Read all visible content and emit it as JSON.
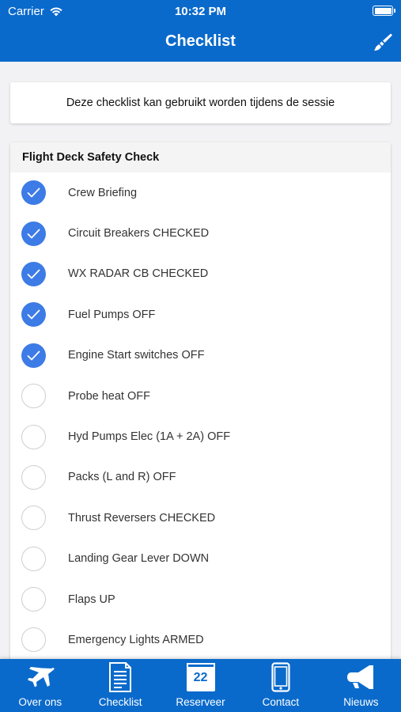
{
  "status_bar": {
    "carrier": "Carrier",
    "time": "10:32 PM"
  },
  "nav": {
    "title": "Checklist",
    "action_icon": "paint-brush-icon"
  },
  "info": {
    "text": "Deze checklist kan gebruikt worden tijdens de sessie"
  },
  "checklist": {
    "header": "Flight Deck Safety Check",
    "items": [
      {
        "label": "Crew Briefing",
        "checked": true
      },
      {
        "label": "Circuit Breakers CHECKED",
        "checked": true
      },
      {
        "label": "WX RADAR CB CHECKED",
        "checked": true
      },
      {
        "label": "Fuel Pumps OFF",
        "checked": true
      },
      {
        "label": "Engine Start switches OFF",
        "checked": true
      },
      {
        "label": "Probe heat OFF",
        "checked": false
      },
      {
        "label": "Hyd Pumps Elec (1A + 2A) OFF",
        "checked": false
      },
      {
        "label": "Packs (L and R) OFF",
        "checked": false
      },
      {
        "label": "Thrust Reversers CHECKED",
        "checked": false
      },
      {
        "label": "Landing Gear Lever DOWN",
        "checked": false
      },
      {
        "label": "Flaps UP",
        "checked": false
      },
      {
        "label": "Emergency Lights ARMED",
        "checked": false
      }
    ]
  },
  "tabbar": {
    "tabs": [
      {
        "label": "Over ons",
        "icon": "airplane-icon"
      },
      {
        "label": "Checklist",
        "icon": "document-icon"
      },
      {
        "label": "Reserveer",
        "icon": "calendar-icon",
        "day": "22"
      },
      {
        "label": "Contact",
        "icon": "phone-icon"
      },
      {
        "label": "Nieuws",
        "icon": "megaphone-icon"
      }
    ]
  },
  "colors": {
    "brand_blue": "#0a6acb",
    "check_blue": "#3d7be6"
  }
}
